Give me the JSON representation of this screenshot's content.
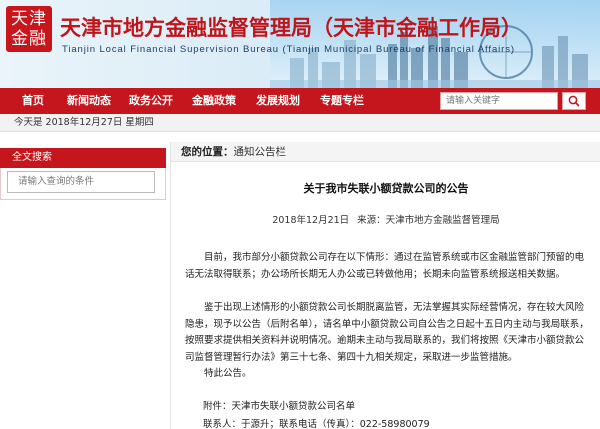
{
  "header": {
    "logo_text": "天津\n金融",
    "title_cn": "天津市地方金融监督管理局（天津市金融工作局）",
    "title_en": "Tianjin Local Financial Supervision Bureau (Tianjin Municipal Bureau of Financial Affairs)"
  },
  "nav": {
    "items": [
      {
        "label": "首页"
      },
      {
        "label": "新闻动态"
      },
      {
        "label": "政务公开"
      },
      {
        "label": "金融政策"
      },
      {
        "label": "发展规划"
      },
      {
        "label": "专题专栏"
      }
    ],
    "search_placeholder": "请输入关键字"
  },
  "datebar": {
    "text": "今天是 2018年12月27日 星期四"
  },
  "sidebar": {
    "heading": "全文搜索",
    "input_placeholder": "请输入查询的条件"
  },
  "breadcrumb": {
    "label": "您的位置：",
    "path": "通知公告栏"
  },
  "article": {
    "title": "关于我市失联小额贷款公司的公告",
    "date": "2018年12月21日",
    "source": "来源：天津市地方金融监督管理局",
    "p1": "目前，我市部分小额贷款公司存在以下情形：通过在监管系统或市区金融监管部门预留的电话无法取得联系；办公场所长期无人办公或已转做他用；长期未向监管系统报送相关数据。",
    "p2": "鉴于出现上述情形的小额贷款公司长期脱离监管，无法掌握其实际经营情况，存在较大风险隐患，现予以公告（后附名单），请名单中小额贷款公司自公告之日起十五日内主动与我局联系，按照要求提供相关资料并说明情况。逾期未主动与我局联系的，我们将按照《天津市小额贷款公司监督管理暂行办法》第三十七条、第四十九相关规定，采取进一步监管措施。",
    "p3": "特此公告。",
    "attachment": "附件：天津市失联小额贷款公司名单",
    "contact": "联系人：于源升；联系电话（传真）：022-58980079"
  }
}
